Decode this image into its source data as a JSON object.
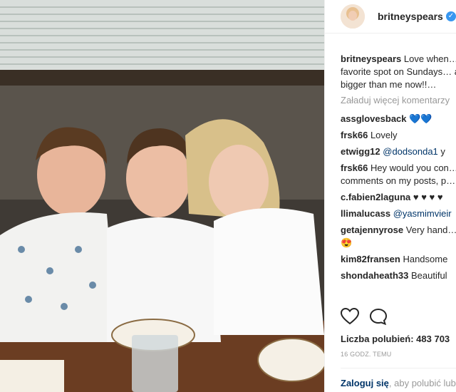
{
  "post": {
    "username": "britneyspears",
    "caption_user": "britneyspears",
    "caption_text": "Love when… favorite spot on Sundays… are bigger than me now!!…",
    "load_more": "Załaduj więcej komentarzy",
    "likes_label": "Liczba polubień: 483 703",
    "timestamp": "16 GODZ. TEMU",
    "login_link": "Zaloguj się",
    "login_rest": ", aby polubić lub…"
  },
  "comments": [
    {
      "user": "assglovesback",
      "text": "💙💙"
    },
    {
      "user": "frsk66",
      "text": "Lovely"
    },
    {
      "user": "etwigg12",
      "mention": "@dodsonda1",
      "text": " y"
    },
    {
      "user": "frsk66",
      "text": "Hey would you con… comments on my posts, p… Iran"
    },
    {
      "user": "c.fabien2laguna",
      "text": "♥ ♥ ♥ ♥"
    },
    {
      "user": "llimalucass",
      "mention": "@yasmimvieir",
      "text": ""
    },
    {
      "user": "getajennyrose",
      "text": "Very hand… 😍😍"
    },
    {
      "user": "kim82fransen",
      "text": "Handsome"
    },
    {
      "user": "shondaheath33",
      "text": "Beautiful"
    }
  ],
  "icons": {
    "like": "heart-icon",
    "comment": "comment-icon",
    "verified": "verified-badge-icon"
  },
  "colors": {
    "link": "#003569",
    "muted": "#999999",
    "verified": "#3897f0"
  }
}
